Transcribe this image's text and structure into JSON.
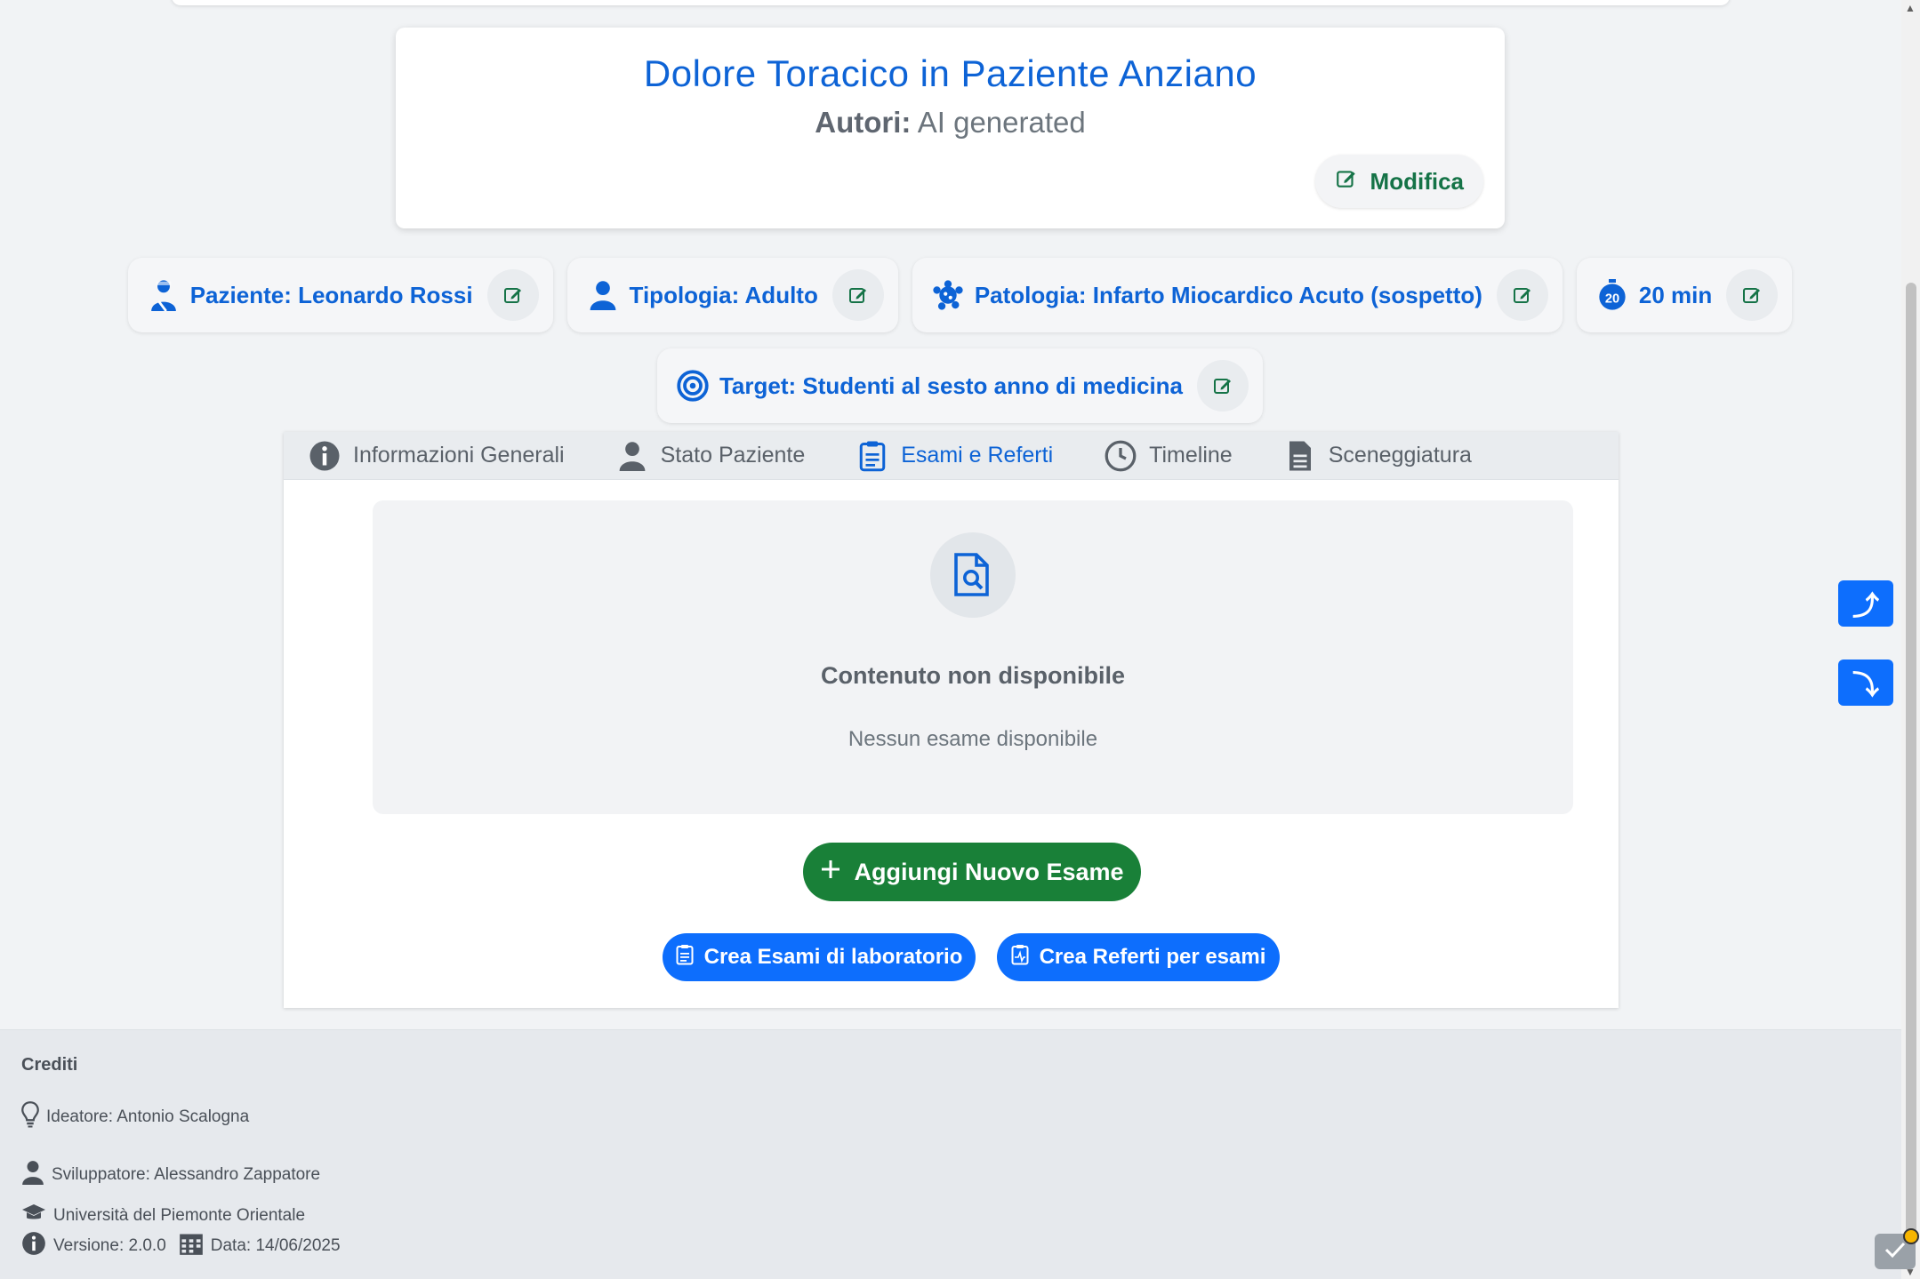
{
  "case": {
    "title": "Dolore Toracico in Paziente Anziano",
    "authors_label": "Autori:",
    "authors_value": "AI generated",
    "edit_label": "Modifica"
  },
  "chips": [
    {
      "icon": "user-injured-icon",
      "label": "Paziente: Leonardo Rossi"
    },
    {
      "icon": "user-icon",
      "label": "Tipologia: Adulto"
    },
    {
      "icon": "virus-icon",
      "label": "Patologia: Infarto Miocardico Acuto (sospetto)"
    },
    {
      "icon": "stopwatch-20-icon",
      "label": "20 min"
    },
    {
      "icon": "target-icon",
      "label": "Target: Studenti al sesto anno di medicina"
    }
  ],
  "tabs": [
    {
      "icon": "info-icon",
      "label": "Informazioni Generali",
      "active": false
    },
    {
      "icon": "user-icon",
      "label": "Stato Paziente",
      "active": false
    },
    {
      "icon": "clipboard-icon",
      "label": "Esami e Referti",
      "active": true
    },
    {
      "icon": "clock-icon",
      "label": "Timeline",
      "active": false
    },
    {
      "icon": "document-icon",
      "label": "Sceneggiatura",
      "active": false
    }
  ],
  "empty_state": {
    "icon": "file-search-icon",
    "title": "Contenuto non disponibile",
    "message": "Nessun esame disponibile"
  },
  "actions": {
    "add_exam": "Aggiungi Nuovo Esame",
    "create_lab": "Crea Esami di laboratorio",
    "create_reports": "Crea Referti per esami"
  },
  "footer": {
    "heading": "Crediti",
    "creator": "Ideatore: Antonio Scalogna",
    "developer": "Sviluppatore: Alessandro Zappatore",
    "university": "Università del Piemonte Orientale",
    "version": "Versione: 2.0.0",
    "date": "Data: 14/06/2025"
  },
  "float_buttons": {
    "up": "⤴",
    "down": "⤵"
  },
  "colors": {
    "primary": "#0d63d6",
    "success": "#198038",
    "button_blue": "#0d6efd",
    "edit_green": "#157347"
  }
}
